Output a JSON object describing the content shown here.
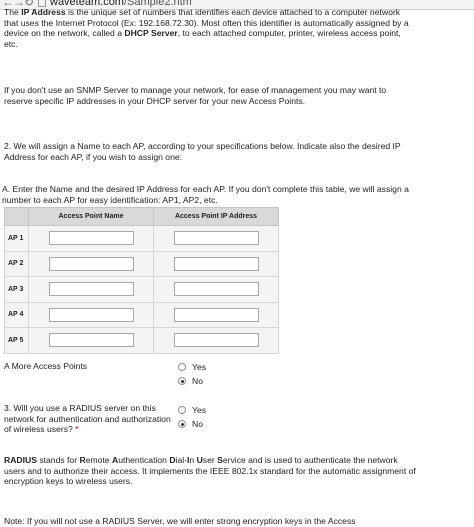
{
  "browser": {
    "back_icon": "arrow-left-icon",
    "forward_icon": "arrow-right-icon",
    "reload_icon": "reload-icon",
    "page_icon": "page-icon",
    "url_host": "waveteam.com",
    "url_path": "/Sample2.htm"
  },
  "intro": {
    "p1_start": "The ",
    "p1_bold": "IP Address",
    "p1_mid": " is the unique set of numbers that identifies each device attached to a computer network that uses the Internet Protocol (Ex: 192.168.72.30). Most often this identifier is automatically assigned by a device on the network, called a ",
    "p1_bold2": "DHCP Server",
    "p1_end": ", to each attached computer, printer, wireless access point, etc.",
    "p2": "If you don't use an SNMP Server to manage your network, for ease of management you may want to reserve specific IP addresses in your DHCP server for your new Access Points."
  },
  "step2": {
    "text": "2. We will assign a Name to each AP, according to your specifications below. Indicate also the desired IP Address for each AP, if you wish to assign one:"
  },
  "stepA": {
    "text": "A. Enter the Name and the desired IP Address for each AP. If you don't complete this table, we will assign a number to each AP for easy identification: AP1, AP2, etc."
  },
  "ap_table": {
    "col_name": "Access Point Name",
    "col_ip": "Access Point IP Address",
    "rows": [
      {
        "label": "AP 1",
        "name": "",
        "ip": ""
      },
      {
        "label": "AP 2",
        "name": "",
        "ip": ""
      },
      {
        "label": "AP 3",
        "name": "",
        "ip": ""
      },
      {
        "label": "AP 4",
        "name": "",
        "ip": ""
      },
      {
        "label": "AP 5",
        "name": "",
        "ip": ""
      }
    ]
  },
  "more_aps": {
    "label": "A More Access Points",
    "yes": "Yes",
    "no": "No",
    "selected": "No"
  },
  "radius_q": {
    "label": "3. Will you use a RADIUS server on this network for authentication and authorization of wireless users?",
    "required_mark": "*",
    "yes": "Yes",
    "no": "No",
    "selected": "No"
  },
  "radius_info": {
    "b1": "RADIUS",
    "t1": " stands for ",
    "b2": "R",
    "t2": "emote ",
    "b3": "A",
    "t3": "uthentication ",
    "b4": "D",
    "t4": "ial-",
    "b5": "I",
    "t5": "n ",
    "b6": "U",
    "t6": "ser ",
    "b7": "S",
    "t7": "ervice and is used to authenticate the network users and to authorize their access. It implements the IEEE 802.1x standard for the automatic assignment of encryption keys to wireless users."
  },
  "note": {
    "text": "Note: If you will not use a RADIUS Server, we will enter strong encryption keys in the Access"
  },
  "colors": {
    "accent": "#e53935",
    "table_header": "#d9d9d9"
  }
}
